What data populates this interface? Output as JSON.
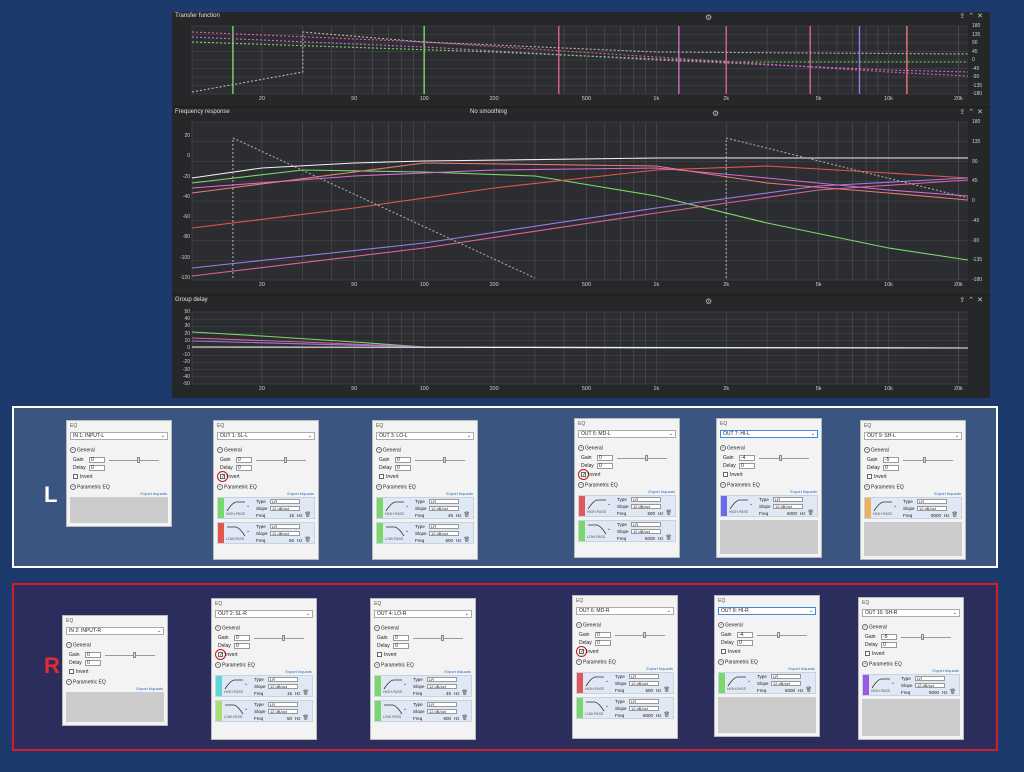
{
  "graphs": {
    "transfer": {
      "title": "Transfer function",
      "ylabels_right": [
        "180",
        "135",
        "90",
        "45",
        "0",
        "-45",
        "-90",
        "-135",
        "-180"
      ]
    },
    "freq": {
      "title": "Frequency response",
      "smoothing": "No smoothing",
      "ylabels_left": [
        "20",
        "0",
        "-20",
        "-40",
        "-60",
        "-80",
        "-100",
        "-120"
      ],
      "ylabels_right": [
        "180",
        "135",
        "90",
        "45",
        "0",
        "-45",
        "-90",
        "-135",
        "-180"
      ]
    },
    "group": {
      "title": "Group delay",
      "ylabels_left": [
        "50",
        "40",
        "30",
        "20",
        "10",
        "0",
        "-10",
        "-20",
        "-30",
        "-40",
        "-50"
      ]
    },
    "xlabels": [
      "20",
      "50",
      "100",
      "200",
      "500",
      "1k",
      "2k",
      "5k",
      "10k",
      "20k"
    ],
    "icons": {
      "settings": "gear-icon",
      "export": "export-icon",
      "collapse": "collapse-icon",
      "close": "close-icon"
    },
    "colors": {
      "pink": "#e0609a",
      "green": "#7ad86a",
      "red": "#e0584a",
      "purple": "#9a7ae8",
      "magenta": "#d46ad6",
      "white": "#f0f0f0",
      "salmon": "#e87878"
    }
  },
  "groups": {
    "left_letter": "L",
    "right_letter": "R"
  },
  "common": {
    "eq_title": "EQ",
    "general": "General",
    "gain": "Gain",
    "delay": "Delay",
    "invert": "Invert",
    "param_eq": "Parametric EQ",
    "export": "Export biquads",
    "type": "Type",
    "slope": "Slope",
    "freq": "Freq",
    "hz": "Hz",
    "type_val": "LR",
    "slope_val": "12 dB/oct",
    "high_pass": "HIGH-PASS",
    "low_pass": "LOW-PASS"
  },
  "eqs_l": [
    {
      "channel": "IN 1: INPUT-L",
      "gain": "0",
      "delay": "0",
      "inverted": false,
      "filters": []
    },
    {
      "channel": "OUT 1: SL-L",
      "gain": "0",
      "delay": "0",
      "inverted": true,
      "filters": [
        {
          "kind": "high",
          "freq": "15",
          "color": "#7ad86a"
        },
        {
          "kind": "low",
          "freq": "50",
          "color": "#e0584a"
        }
      ]
    },
    {
      "channel": "OUT 3: LO-L",
      "gain": "0",
      "delay": "0",
      "inverted": false,
      "filters": [
        {
          "kind": "high",
          "freq": "45",
          "color": "#7ad86a"
        },
        {
          "kind": "low",
          "freq": "600",
          "color": "#7ad86a"
        }
      ]
    },
    {
      "channel": "OUT 5: MD-L",
      "gain": "0",
      "delay": "0",
      "inverted": true,
      "filters": [
        {
          "kind": "high",
          "freq": "600",
          "color": "#e05858"
        },
        {
          "kind": "low",
          "freq": "6000",
          "color": "#7ad86a"
        }
      ]
    },
    {
      "channel": "OUT 7: HI-L",
      "gain": "-4",
      "delay": "0",
      "inverted": false,
      "filters": [
        {
          "kind": "high",
          "freq": "6000",
          "color": "#6a6ae8"
        }
      ]
    },
    {
      "channel": "OUT 9: SH-L",
      "gain": "-5",
      "delay": "0",
      "inverted": false,
      "filters": [
        {
          "kind": "high",
          "freq": "9000",
          "color": "#f0b060"
        }
      ]
    }
  ],
  "eqs_r": [
    {
      "channel": "IN 2: INPUT-R",
      "gain": "0",
      "delay": "0",
      "inverted": false,
      "filters": []
    },
    {
      "channel": "OUT 2: SL-R",
      "gain": "0",
      "delay": "0",
      "inverted": true,
      "filters": [
        {
          "kind": "high",
          "freq": "15",
          "color": "#5ad8d8"
        },
        {
          "kind": "low",
          "freq": "50",
          "color": "#a8e070"
        }
      ]
    },
    {
      "channel": "OUT 4: LO-R",
      "gain": "0",
      "delay": "0",
      "inverted": false,
      "filters": [
        {
          "kind": "high",
          "freq": "45",
          "color": "#7ad86a"
        },
        {
          "kind": "low",
          "freq": "600",
          "color": "#7ad86a"
        }
      ]
    },
    {
      "channel": "OUT 6: MD-R",
      "gain": "0",
      "delay": "0",
      "inverted": true,
      "filters": [
        {
          "kind": "high",
          "freq": "600",
          "color": "#e05858"
        },
        {
          "kind": "low",
          "freq": "6000",
          "color": "#7ad86a"
        }
      ]
    },
    {
      "channel": "OUT 8: HI-R",
      "gain": "-4",
      "delay": "0",
      "inverted": false,
      "filters": [
        {
          "kind": "high",
          "freq": "6000",
          "color": "#7ad86a"
        }
      ]
    },
    {
      "channel": "OUT 10: SH-R",
      "gain": "-5",
      "delay": "0",
      "inverted": false,
      "filters": [
        {
          "kind": "high",
          "freq": "9000",
          "color": "#9a5ae0"
        }
      ]
    }
  ]
}
